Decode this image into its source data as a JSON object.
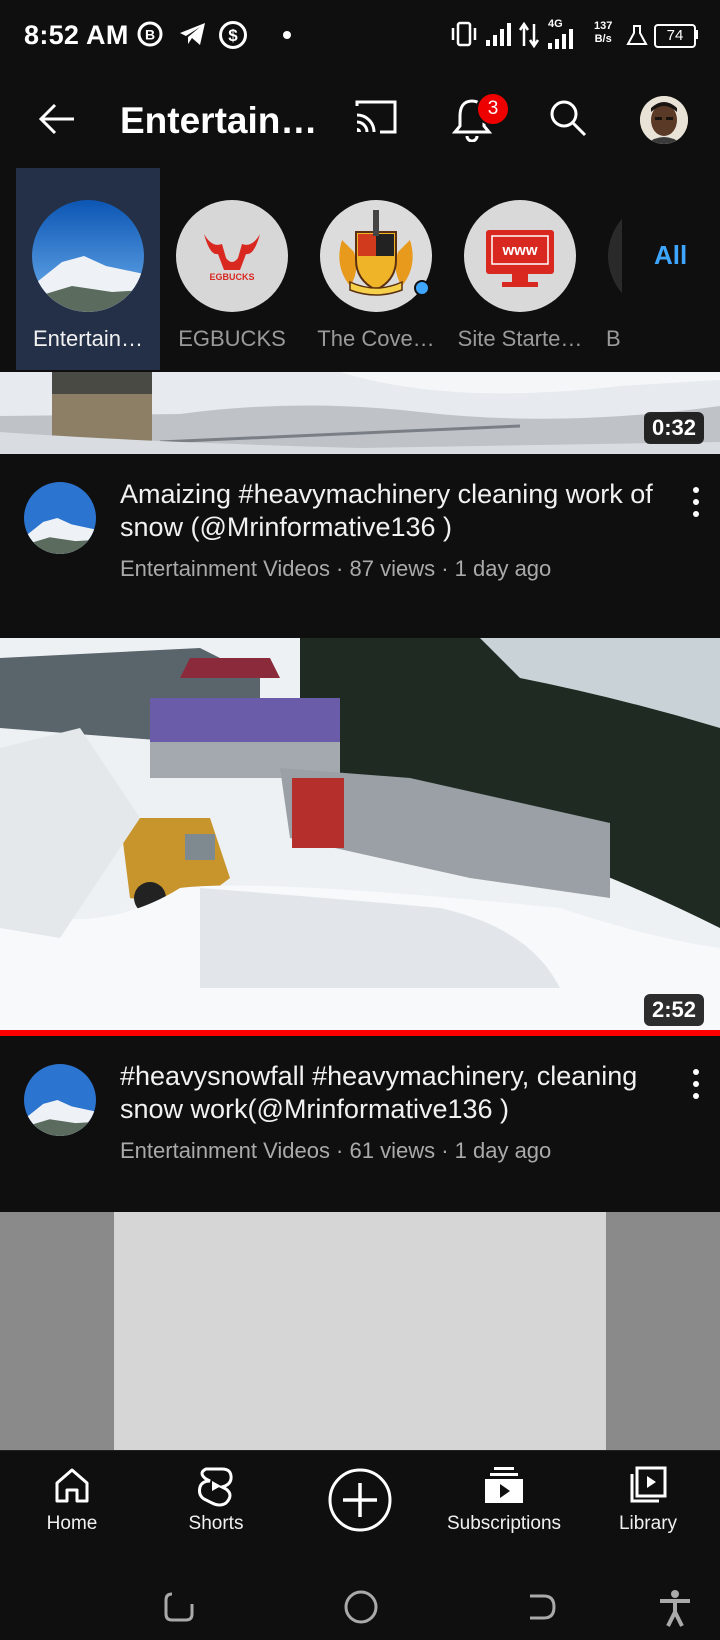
{
  "status_bar": {
    "time": "8:52 AM",
    "net_type": "4G",
    "speed_value": "137",
    "speed_unit": "B/s",
    "battery": "74"
  },
  "header": {
    "title": "Entertain…",
    "notification_count": "3"
  },
  "channels": [
    {
      "label": "Entertain…",
      "selected": true
    },
    {
      "label": "EGBUCKS",
      "logo_text": "EGBUCKS"
    },
    {
      "label": "The Cove…"
    },
    {
      "label": "Site Starte…",
      "logo_text": "www"
    },
    {
      "label": "B"
    }
  ],
  "all_label": "All",
  "videos": [
    {
      "duration": "0:32",
      "title": "Amaizing #heavymachinery cleaning work of snow (@Mrinformative136 )",
      "meta": "Entertainment Videos · 87 views · 1 day ago"
    },
    {
      "duration": "2:52",
      "title": "#heavysnowfall #heavymachinery, cleaning snow work(@Mrinformative136 )",
      "meta": "Entertainment Videos · 61 views · 1 day ago",
      "watched_progress": 1.0
    }
  ],
  "nav": {
    "home": "Home",
    "shorts": "Shorts",
    "subscriptions": "Subscriptions",
    "library": "Library"
  },
  "colors": {
    "accent_blue": "#3ea6ff",
    "progress_red": "#ff0000",
    "badge_red": "#e00000",
    "selected_chip": "#243047"
  }
}
